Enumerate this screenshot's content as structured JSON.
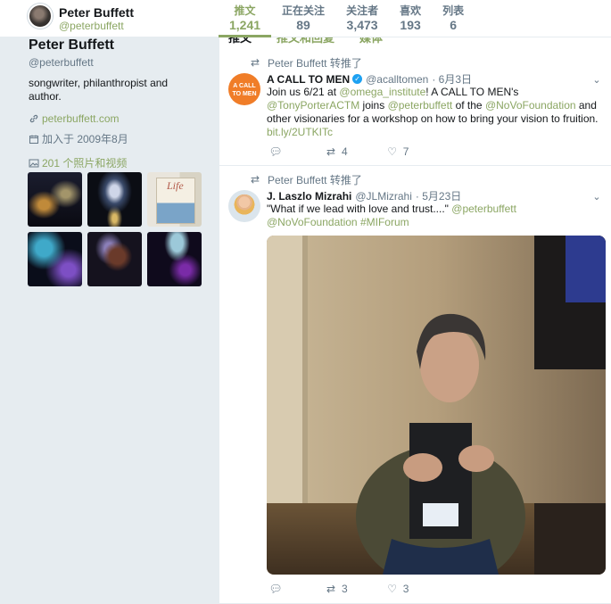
{
  "header": {
    "name": "Peter Buffett",
    "handle": "@peterbuffett",
    "stats": [
      {
        "label": "推文",
        "value": "1,241",
        "active": true
      },
      {
        "label": "正在关注",
        "value": "89"
      },
      {
        "label": "关注者",
        "value": "3,473"
      },
      {
        "label": "喜欢",
        "value": "193"
      },
      {
        "label": "列表",
        "value": "6"
      }
    ]
  },
  "profile": {
    "name": "Peter Buffett",
    "handle": "@peterbuffett",
    "bio": "songwriter, philanthropist and author.",
    "website": "peterbuffett.com",
    "joined": "加入于 2009年8月",
    "media_link": "201 个照片和视频",
    "media_thumb_book_text": "Life"
  },
  "timeline": {
    "subtabs": [
      "推文",
      "推文和回复",
      "媒体"
    ],
    "tweets": [
      {
        "retweet_by": "Peter Buffett 转推了",
        "avatar_text": "A CALL TO MEN",
        "author": "A CALL TO MEN",
        "handle": "@acalltomen",
        "date": "· 6月3日",
        "text": {
          "p1": "Join us 6/21 at ",
          "l1": "@omega_institute",
          "p2": "!  A CALL TO MEN's ",
          "l2": "@TonyPorterACTM",
          "p3": " joins ",
          "l3": "@peterbuffett",
          "p4": " of the ",
          "l4": "@NoVoFoundation",
          "p5": " and other visionaries for a workshop on how to bring your vision to fruition. ",
          "l5": "bit.ly/2UTKITc"
        },
        "retweets": "4",
        "likes": "7"
      },
      {
        "retweet_by": "Peter Buffett 转推了",
        "author": "J. Laszlo Mizrahi",
        "handle": "@JLMizrahi",
        "date": "· 5月23日",
        "text": {
          "p1": "\"What if we lead with love and trust....\" ",
          "l1": "@peterbuffett",
          "l2": "@NoVoFoundation",
          "l3": "#MIForum"
        },
        "retweets": "3",
        "likes": "3"
      }
    ]
  },
  "colors": {
    "accent": "#8ba663",
    "muted": "#657786",
    "background": "#e6ecf0",
    "verified": "#1da1f2",
    "acm_avatar": "#f07d28"
  },
  "icons": [
    "link-icon",
    "calendar-icon",
    "photo-icon",
    "retweet-icon",
    "reply-icon",
    "like-icon",
    "chevron-down-icon",
    "verified-icon"
  ]
}
